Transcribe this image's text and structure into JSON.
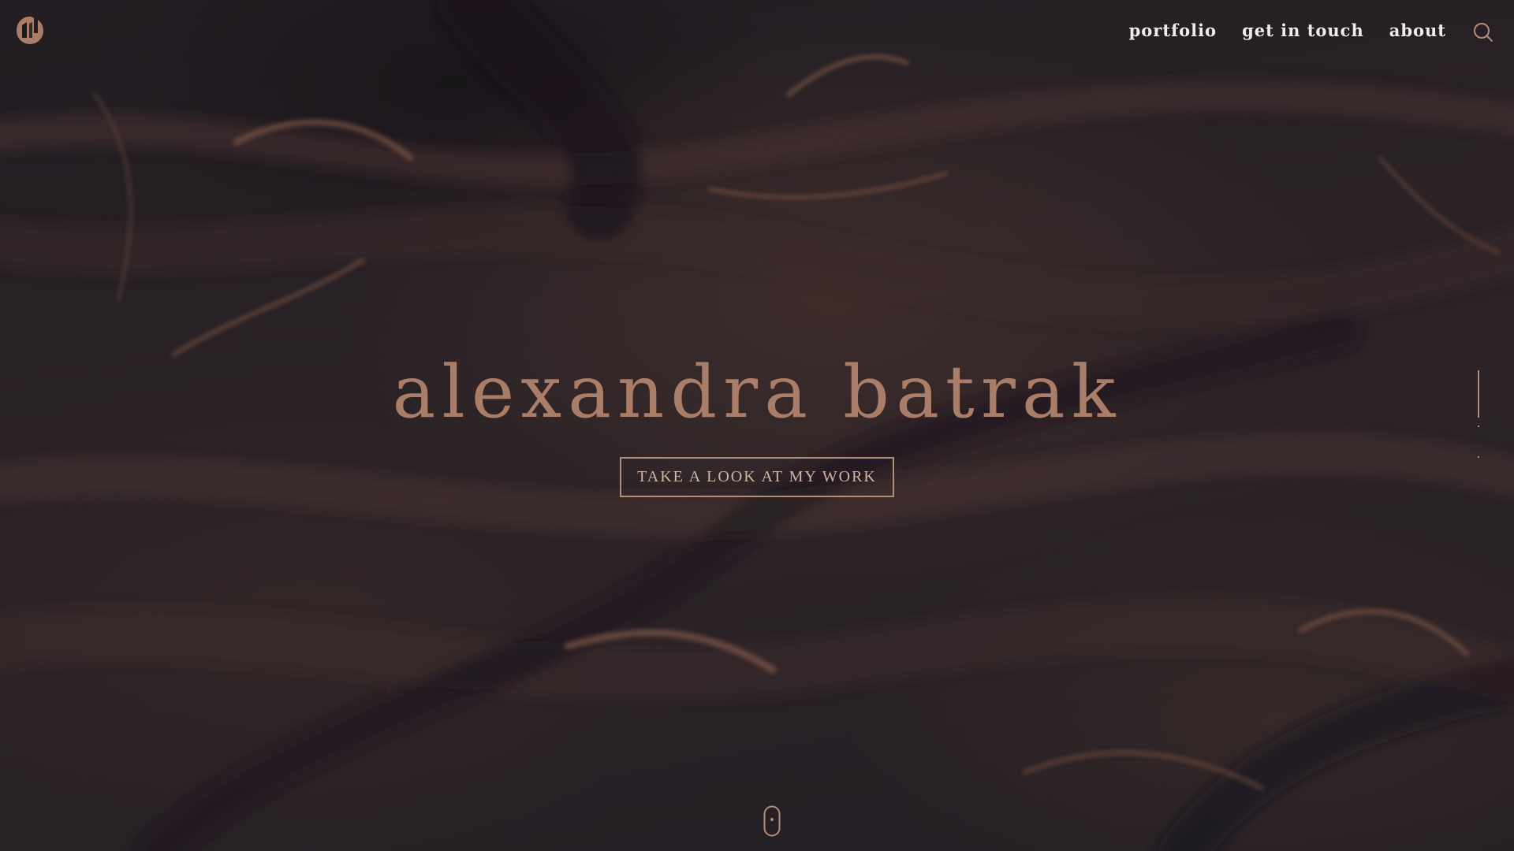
{
  "nav": {
    "items": [
      {
        "label": "portfolio"
      },
      {
        "label": "get in touch"
      },
      {
        "label": "about"
      }
    ]
  },
  "hero": {
    "name": "alexandra batrak",
    "cta_label": "TAKE A LOOK AT MY WORK"
  },
  "icons": {
    "logo": "ab-monogram-logo",
    "search": "search-icon",
    "scroll": "mouse-scroll-icon"
  },
  "colors": {
    "accent": "#a97d68",
    "cta_border": "#b28d78",
    "nav_text": "#f3ece8",
    "background": "#1d1a1f"
  }
}
